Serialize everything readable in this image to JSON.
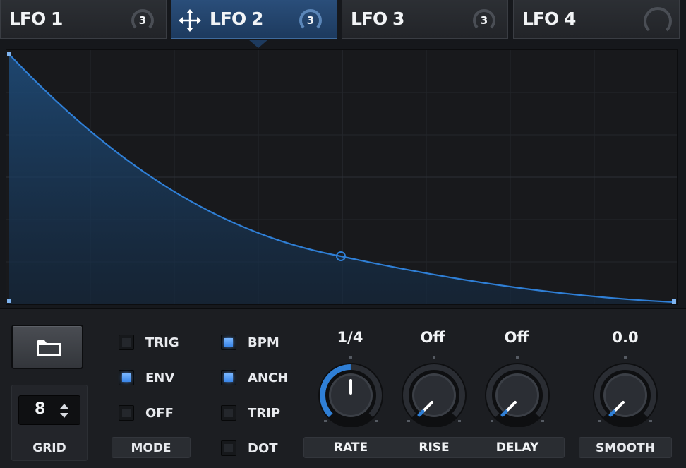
{
  "tabs": [
    {
      "label": "LFO 1",
      "badge": "3",
      "active": false
    },
    {
      "label": "LFO 2",
      "badge": "3",
      "active": true,
      "icon": "move-icon"
    },
    {
      "label": "LFO 3",
      "badge": "3",
      "active": false
    },
    {
      "label": "LFO 4",
      "badge": "",
      "active": false
    }
  ],
  "colors": {
    "accent": "#2f7fd6",
    "curve": "#2f7fd6",
    "tab_active": "#1d3a5e",
    "background": "#16181c",
    "checkbox_on": "#5aa0ff"
  },
  "editor": {
    "shape": "exponential-decay",
    "grid_divisions": 8
  },
  "folder_button": {
    "icon": "folder-icon"
  },
  "grid": {
    "value": "8",
    "label": "GRID"
  },
  "mode": {
    "label": "MODE",
    "options": [
      {
        "label": "TRIG",
        "checked": false
      },
      {
        "label": "ENV",
        "checked": true
      },
      {
        "label": "OFF",
        "checked": false
      }
    ]
  },
  "timing": {
    "options": [
      {
        "label": "BPM",
        "checked": true
      },
      {
        "label": "ANCH",
        "checked": true
      },
      {
        "label": "TRIP",
        "checked": false
      },
      {
        "label": "DOT",
        "checked": false
      }
    ]
  },
  "knobs": {
    "rate": {
      "label": "RATE",
      "value": "1/4"
    },
    "rise": {
      "label": "RISE",
      "value": "Off"
    },
    "delay": {
      "label": "DELAY",
      "value": "Off"
    },
    "smooth": {
      "label": "SMOOTH",
      "value": "0.0"
    }
  }
}
